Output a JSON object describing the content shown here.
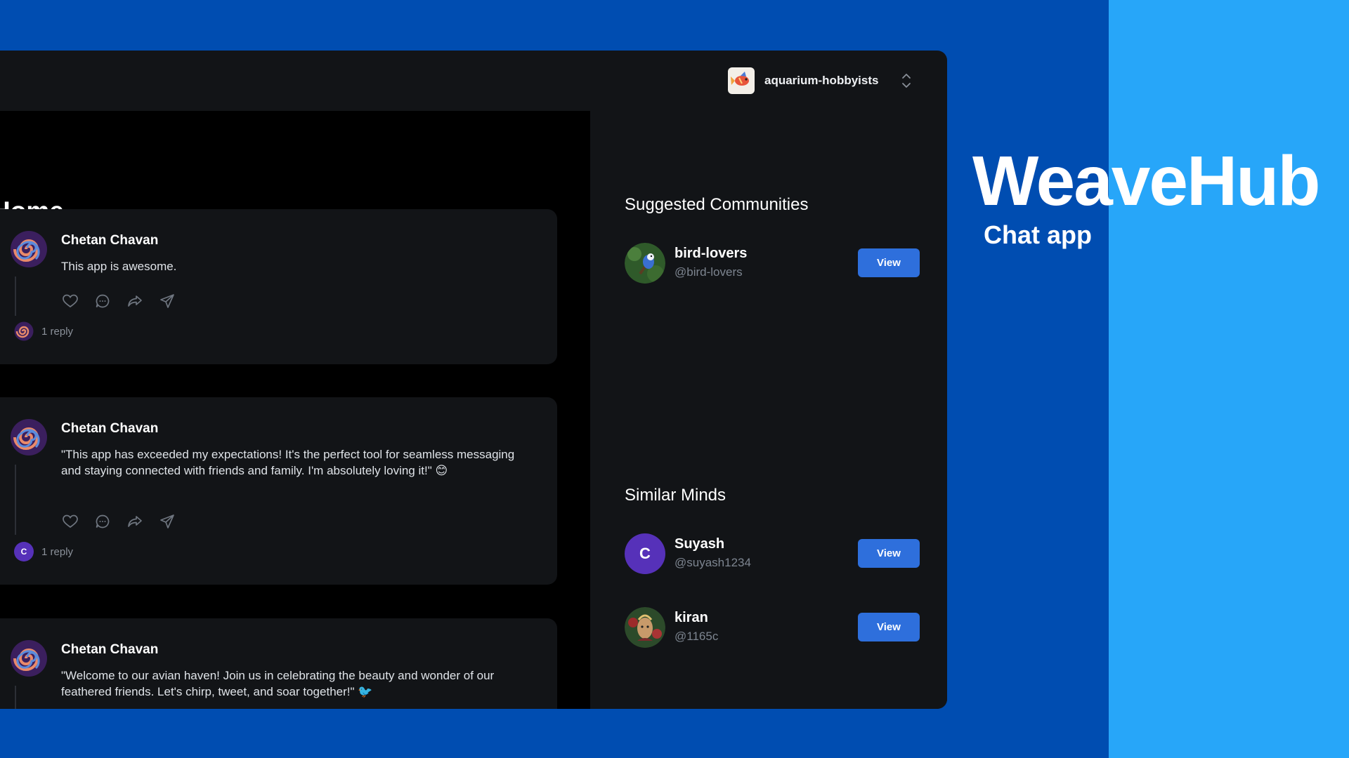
{
  "brand": {
    "title": "WeaveHub",
    "subtitle": "Chat app"
  },
  "header": {
    "org_name": "aquarium-hobbyists"
  },
  "feed": {
    "title": "Home",
    "posts": [
      {
        "author": "Chetan Chavan",
        "content": "This app is awesome.",
        "replies": "1 reply"
      },
      {
        "author": "Chetan Chavan",
        "content": "\"This app has exceeded my expectations! It's the perfect tool for seamless messaging and staying connected with friends and family. I'm absolutely loving it!\" 😊",
        "replies": "1 reply",
        "reply_avatar_letter": "C"
      },
      {
        "author": "Chetan Chavan",
        "content": "\"Welcome to our avian haven! Join us in celebrating the beauty and wonder of our feathered friends. Let's chirp, tweet, and soar together!\" 🐦"
      }
    ]
  },
  "sidebar": {
    "communities_title": "Suggested Communities",
    "communities": [
      {
        "name": "bird-lovers",
        "handle": "@bird-lovers",
        "button": "View"
      }
    ],
    "minds_title": "Similar Minds",
    "minds": [
      {
        "name": "Suyash",
        "handle": "@suyash1234",
        "avatar_letter": "C",
        "button": "View"
      },
      {
        "name": "kiran",
        "handle": "@1165c",
        "button": "View"
      }
    ]
  },
  "icons": [
    "heart-icon",
    "comment-icon",
    "share-icon",
    "send-icon",
    "chevron-updown-icon"
  ],
  "colors": {
    "page_bg": "#004db1",
    "accent_bg": "#27a6f9",
    "panel_bg": "#121417",
    "feed_bg": "#000000",
    "button": "#2e6fdc",
    "letter_avatar": "#5631b9"
  }
}
